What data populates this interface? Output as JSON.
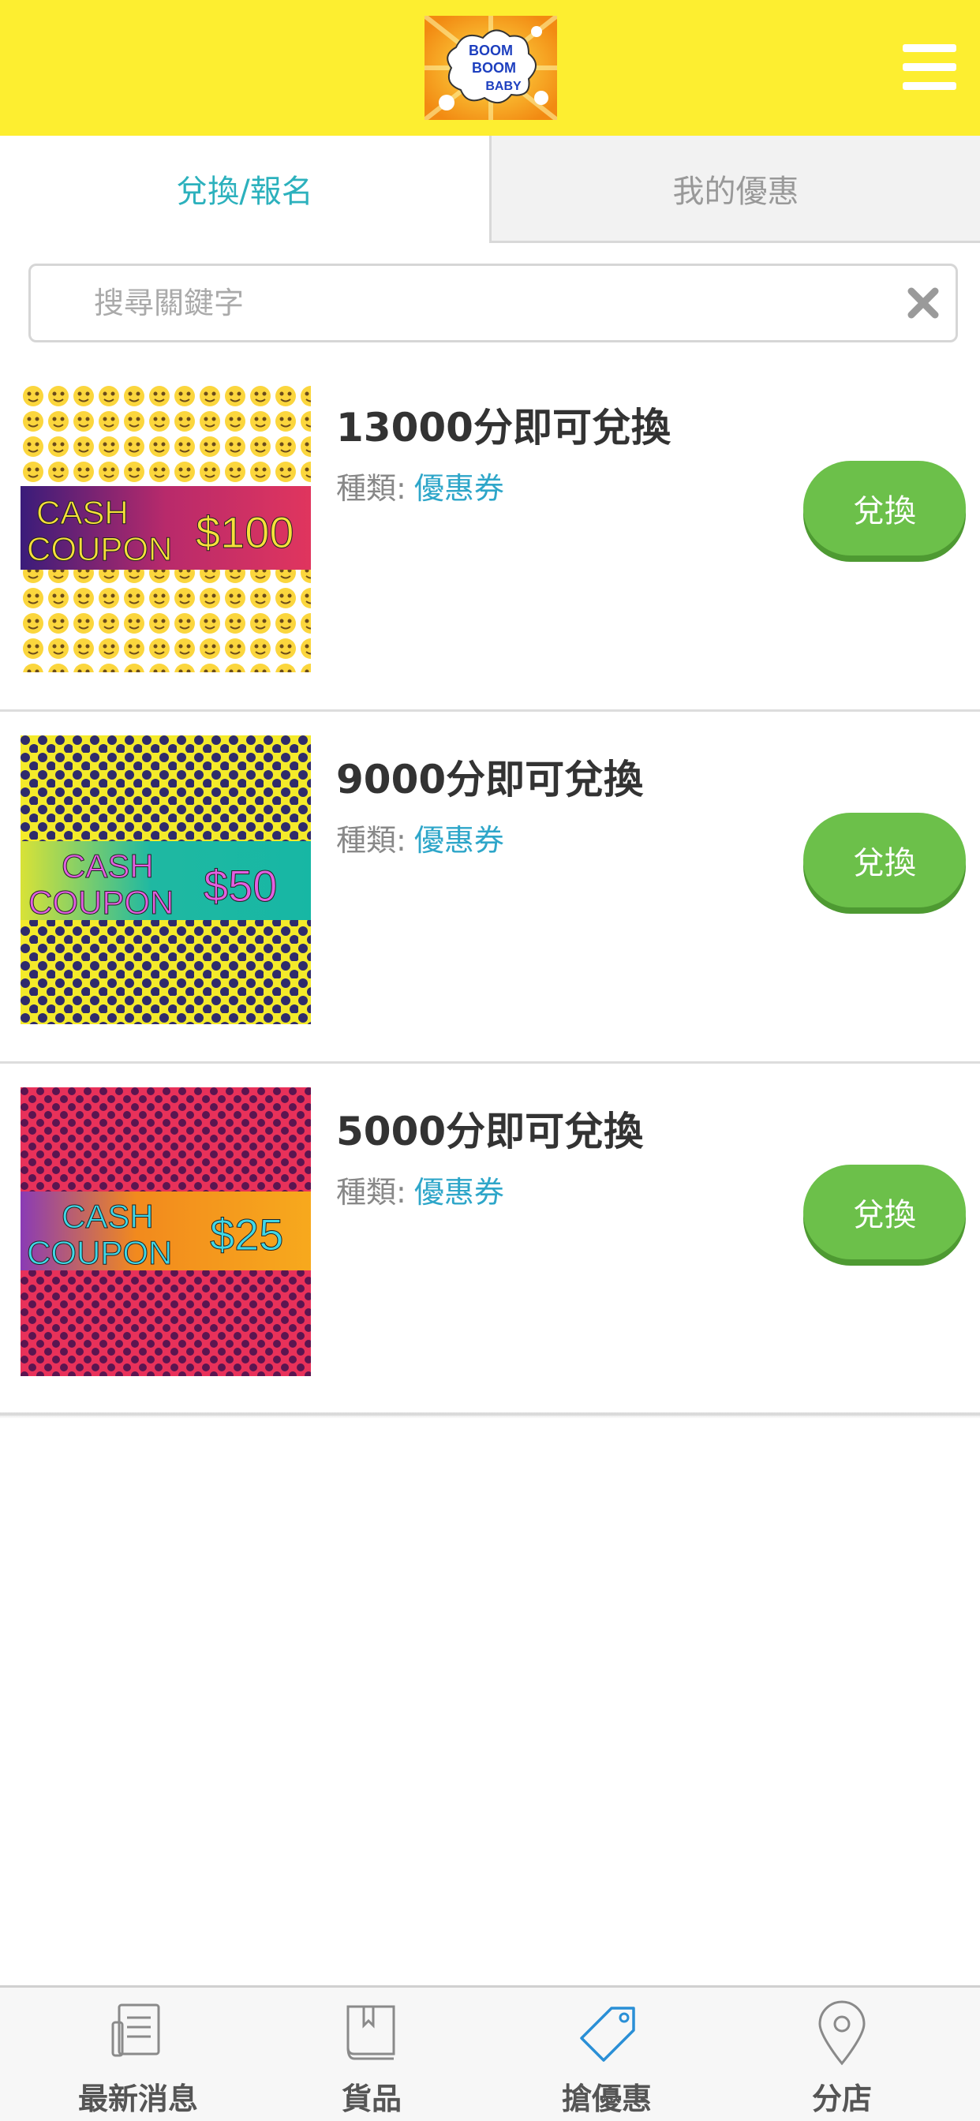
{
  "header": {
    "logo_text": [
      "BOOM",
      "BOOM",
      "BABY"
    ],
    "menu_icon": "hamburger-menu-icon",
    "background_color": "#fdee30"
  },
  "tabs": [
    {
      "label": "兌換/報名",
      "active": true
    },
    {
      "label": "我的優惠",
      "active": false
    }
  ],
  "search": {
    "placeholder": "搜尋關鍵字",
    "value": "",
    "clear_icon": "clear-x-icon"
  },
  "coupons": [
    {
      "title": "13000分即可兌換",
      "type_label": "種類:",
      "type_value": "優惠券",
      "button_label": "兌換",
      "image": {
        "line1": "CASH",
        "line2": "COUPON",
        "amount": "$100",
        "pattern": "emoji",
        "bg": "#fbd63d",
        "band": "#e0355e"
      }
    },
    {
      "title": "9000分即可兌換",
      "type_label": "種類:",
      "type_value": "優惠券",
      "button_label": "兌換",
      "image": {
        "line1": "CASH",
        "line2": "COUPON",
        "amount": "$50",
        "pattern": "dots",
        "bg": "#f4ea2a",
        "band": "#17b7a4"
      }
    },
    {
      "title": "5000分即可兌換",
      "type_label": "種類:",
      "type_value": "優惠券",
      "button_label": "兌換",
      "image": {
        "line1": "CASH",
        "line2": "COUPON",
        "amount": "$25",
        "pattern": "dots",
        "bg": "#e8315a",
        "band": "#f7a91d"
      }
    }
  ],
  "bottom_nav": [
    {
      "label": "最新消息",
      "icon": "newspaper-icon",
      "active": false
    },
    {
      "label": "貨品",
      "icon": "book-icon",
      "active": false
    },
    {
      "label": "搶優惠",
      "icon": "price-tag-icon",
      "active": true
    },
    {
      "label": "分店",
      "icon": "location-pin-icon",
      "active": false
    }
  ],
  "colors": {
    "accent": "#2cb1bd",
    "button_green": "#6cc04a",
    "type_link": "#2ea6c9",
    "nav_active": "#2a8fd6"
  }
}
